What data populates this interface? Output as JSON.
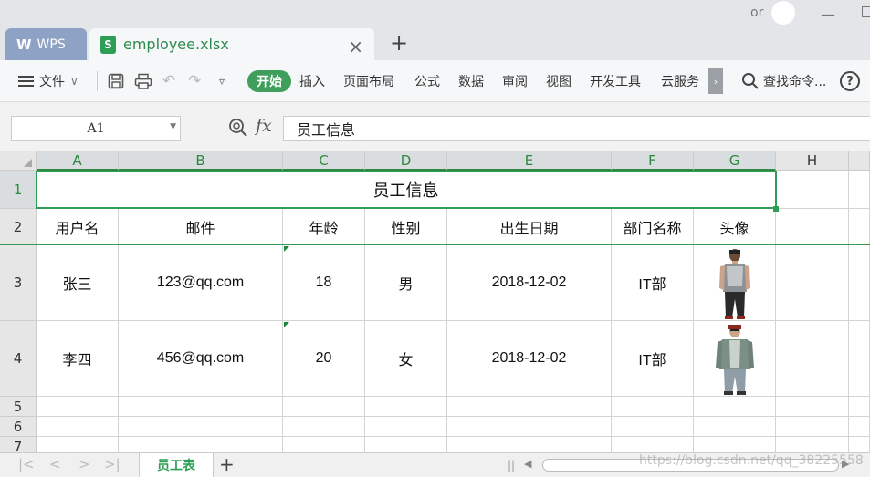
{
  "tabbar": {
    "home_tab_label": "WPS",
    "file_tab_label": "employee.xlsx",
    "file_icon_letter": "S",
    "new_tab_symbol": "+",
    "close_symbol": "×",
    "user_text": "or"
  },
  "ribbon": {
    "file_menu_label": "文件",
    "tabs": [
      "开始",
      "插入",
      "页面布局",
      "公式",
      "数据",
      "审阅",
      "视图",
      "开发工具",
      "云服务"
    ],
    "search_label": "查找命令...",
    "help_symbol": "?"
  },
  "formula_bar": {
    "cell_ref": "A1",
    "fx_label": "fx",
    "content": "员工信息"
  },
  "sheet": {
    "columns": [
      "A",
      "B",
      "C",
      "D",
      "E",
      "F",
      "G",
      "H"
    ],
    "rows": [
      "1",
      "2",
      "3",
      "4",
      "5",
      "6",
      "7"
    ],
    "title": "员工信息",
    "headers": [
      "用户名",
      "邮件",
      "年龄",
      "性别",
      "出生日期",
      "部门名称",
      "头像"
    ],
    "records": [
      {
        "name": "张三",
        "email": "123@qq.com",
        "age": "18",
        "gender": "男",
        "birth": "2018-12-02",
        "dept": "IT部"
      },
      {
        "name": "李四",
        "email": "456@qq.com",
        "age": "20",
        "gender": "女",
        "birth": "2018-12-02",
        "dept": "IT部"
      }
    ]
  },
  "sheetbar": {
    "active_sheet": "员工表",
    "add_symbol": "+",
    "watermark": "https://blog.csdn.net/qq_38225558"
  }
}
